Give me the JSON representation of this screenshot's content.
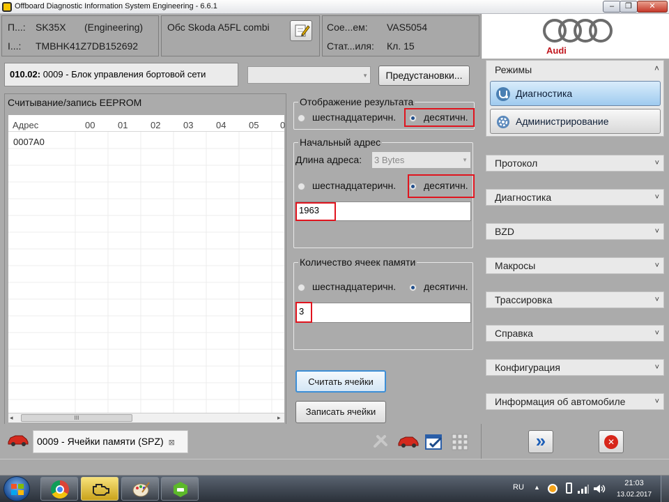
{
  "window": {
    "title": "Offboard Diagnostic Information System Engineering - 6.6.1",
    "minimize": "‒",
    "maximize": "❐",
    "close": "✕"
  },
  "header": {
    "p_label": "П...:",
    "p_value": "SK35X",
    "p_mode": "(Engineering)",
    "i_label": "I...:",
    "i_value": "TMBHK41Z7DB152692",
    "vehicle": "Обс Skoda A5FL combi",
    "conn_label": "Сое...ем:",
    "conn_value": "VAS5054",
    "stat_label": "Стат...иля:",
    "stat_value": "Кл. 15",
    "brand": "Audi"
  },
  "module_bar": {
    "code": "010.02:",
    "text": "0009 - Блок управления бортовой сети",
    "presets_button": "Предустановки..."
  },
  "eeprom": {
    "title": "Считывание/запись EEPROM",
    "columns": [
      "Адрес",
      "00",
      "01",
      "02",
      "03",
      "04",
      "05",
      "0"
    ],
    "rows": [
      [
        "0007A0",
        "",
        "",
        "",
        "",
        "",
        "",
        ""
      ]
    ],
    "scroll_grip": "III",
    "scroll_left": "◂",
    "scroll_right": "▸"
  },
  "result_display": {
    "label": "Отображение результата",
    "hex": "шестнадцатеричн.",
    "dec": "десятичн."
  },
  "start_address": {
    "label": "Начальный адрес",
    "length_label": "Длина адреса:",
    "length_value": "3 Bytes",
    "hex": "шестнадцатеричн.",
    "dec": "десятичн.",
    "value": "1963"
  },
  "cell_count": {
    "label": "Количество ячеек памяти",
    "hex": "шестнадцатеричн.",
    "dec": "десятичн.",
    "value": "3"
  },
  "actions": {
    "read": "Считать ячейки",
    "write": "Записать ячейки"
  },
  "sidebar": {
    "modes_title": "Режимы",
    "modes_chevron": "˄",
    "diagnostics": "Диагностика",
    "admin": "Администрирование",
    "sections": [
      {
        "label": "Протокол",
        "chev": "˅"
      },
      {
        "label": "Диагностика",
        "chev": "˅"
      },
      {
        "label": "BZD",
        "chev": "˅"
      },
      {
        "label": "Макросы",
        "chev": "˅"
      },
      {
        "label": "Трассировка",
        "chev": "˅"
      },
      {
        "label": "Справка",
        "chev": "˅"
      },
      {
        "label": "Конфигурация",
        "chev": "˅"
      },
      {
        "label": "Информация об автомобиле",
        "chev": "˅"
      }
    ]
  },
  "bottom": {
    "tab_label": "0009 - Ячейки памяти (SPZ)",
    "tab_close": "⊠",
    "forward": "»",
    "cancel": "✕"
  },
  "tray": {
    "lang": "RU",
    "time": "21:03",
    "date": "13.02.2017"
  },
  "colors": {
    "highlight": "#e0141e",
    "selected_nav": "#b8d9f5",
    "audi_red": "#c1161e"
  }
}
